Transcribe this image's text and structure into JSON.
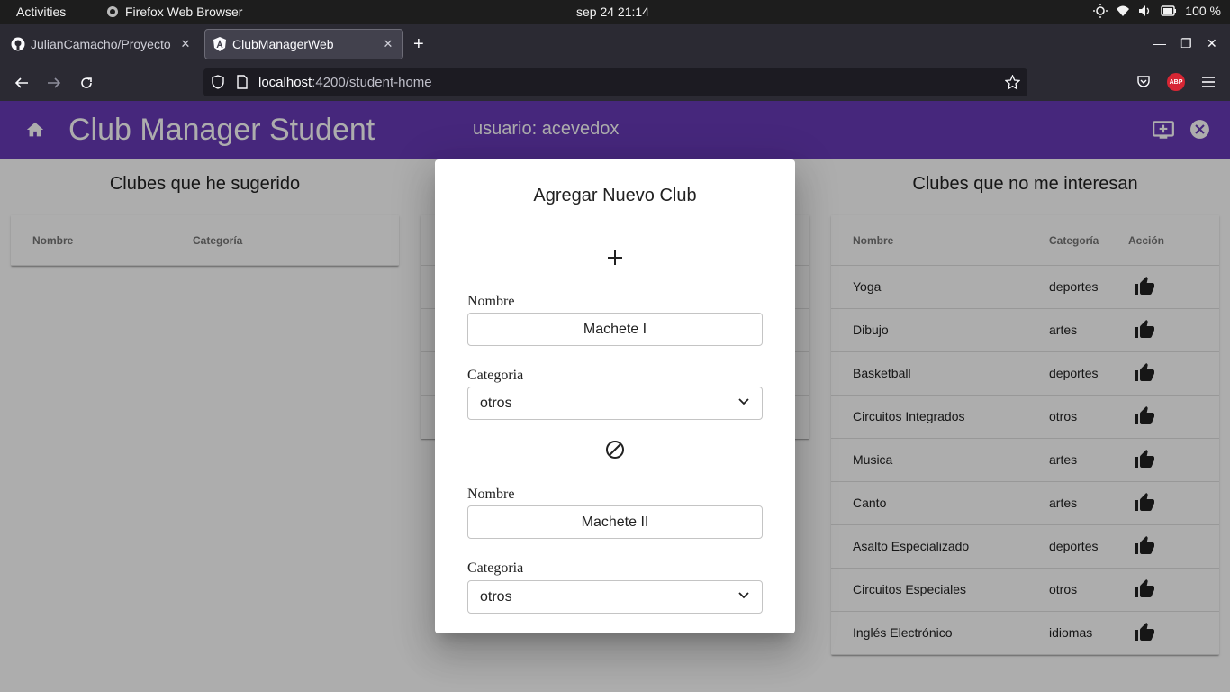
{
  "os": {
    "activities": "Activities",
    "app_name": "Firefox Web Browser",
    "clock": "sep 24  21:14",
    "battery": "100 %"
  },
  "browser": {
    "tabs": [
      {
        "label": "JulianCamacho/Proyecto",
        "active": false
      },
      {
        "label": "ClubManagerWeb",
        "active": true
      }
    ],
    "url_host": "localhost",
    "url_path": ":4200/student-home",
    "abp_label": "ABP"
  },
  "header": {
    "title": "Club Manager Student",
    "user": "usuario: acevedox"
  },
  "suggested": {
    "title": "Clubes que he sugerido",
    "columns": [
      "Nombre",
      "Categoría"
    ]
  },
  "not_interested": {
    "title": "Clubes que no me interesan",
    "columns": [
      "Nombre",
      "Categoría",
      "Acción"
    ],
    "rows": [
      {
        "name": "Yoga",
        "category": "deportes"
      },
      {
        "name": "Dibujo",
        "category": "artes"
      },
      {
        "name": "Basketball",
        "category": "deportes"
      },
      {
        "name": "Circuitos Integrados",
        "category": "otros"
      },
      {
        "name": "Musica",
        "category": "artes"
      },
      {
        "name": "Canto",
        "category": "artes"
      },
      {
        "name": "Asalto Especializado",
        "category": "deportes"
      },
      {
        "name": "Circuitos Especiales",
        "category": "otros"
      },
      {
        "name": "Inglés Electrónico",
        "category": "idiomas"
      }
    ]
  },
  "dialog": {
    "title": "Agregar Nuevo Club",
    "entries": [
      {
        "name_label": "Nombre",
        "name_value": "Machete I",
        "category_label": "Categoria",
        "category_value": "otros"
      },
      {
        "name_label": "Nombre",
        "name_value": "Machete II",
        "category_label": "Categoria",
        "category_value": "otros"
      }
    ]
  },
  "colors": {
    "primary": "#673ab7",
    "backdrop": "rgba(0,0,0,0.32)"
  },
  "icons": [
    "home-icon",
    "add-screen-icon",
    "close-circle-icon",
    "thumb-up-icon",
    "plus-icon",
    "block-icon",
    "chevron-down-icon"
  ]
}
